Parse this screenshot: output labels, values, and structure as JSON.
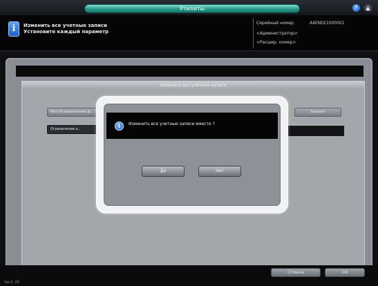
{
  "topbar": {
    "title": "Утилиты",
    "help_icon": "help-icon",
    "user_icon": "user-icon"
  },
  "header": {
    "icon": "info-icon",
    "message_line1": "Изменить все учетные записи",
    "message_line2": "Установите каждый параметр",
    "serial_label": "Серийный номер:",
    "serial_value": "A4EN021000001",
    "admin_label": "<Администратор>",
    "mode_label": "<Расшир. номер>"
  },
  "background_panel": {
    "title": "Изменить все учетные записи",
    "button_1": "Исп./Ограниченные ф..",
    "button_2": "Ограничение к..",
    "button_right": "Закрыть"
  },
  "dialog": {
    "icon": "info-icon",
    "message": "Изменить все учетные записи вместе ?",
    "yes_label": "Да",
    "no_label": "Нет"
  },
  "footer": {
    "cancel_label": "Отмена",
    "ok_label": "OK",
    "version": "Ver.0 .00"
  }
}
